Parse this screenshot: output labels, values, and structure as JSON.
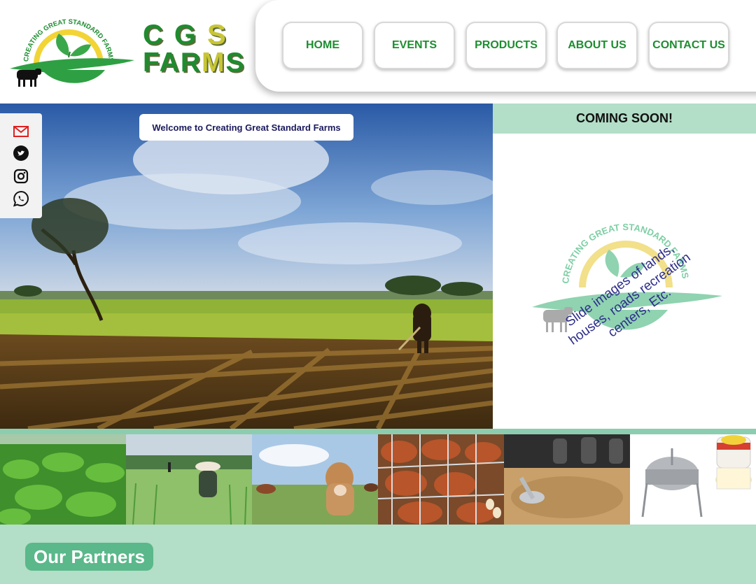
{
  "brand": {
    "logo_arc_text": "CREATING GREAT STANDARD FARMS",
    "line1": [
      "C",
      "G",
      "S"
    ],
    "line2_parts": [
      "FAR",
      "M",
      "S"
    ]
  },
  "nav": {
    "items": [
      {
        "label": "HOME"
      },
      {
        "label": "EVENTS"
      },
      {
        "label": "PRODUCTS"
      },
      {
        "label": "ABOUT US"
      },
      {
        "label": "CONTACT US"
      }
    ]
  },
  "hero": {
    "welcome": "Welcome to Creating Great Standard Farms"
  },
  "social": {
    "icons": [
      "mail-icon",
      "twitter-icon",
      "instagram-icon",
      "whatsapp-icon"
    ]
  },
  "coming_soon": {
    "title": "COMING SOON!",
    "watermark_arc_text": "CREATING GREAT STANDARD FARMS",
    "slide_note": "Slide images of lands, houses, roads recreation centers, Etc."
  },
  "gallery": {
    "tiles": [
      "cassava-field",
      "rice-planting",
      "cattle-pasture",
      "poultry-cages",
      "animal-feed",
      "processing-machine"
    ]
  },
  "partners": {
    "label": "Our Partners"
  },
  "colors": {
    "brand_green": "#1e8d30",
    "accent_yellow": "#c8c634",
    "panel_mint": "#b3dec8",
    "button_green": "#5ab88a",
    "welcome_text": "#1a1a5e"
  }
}
